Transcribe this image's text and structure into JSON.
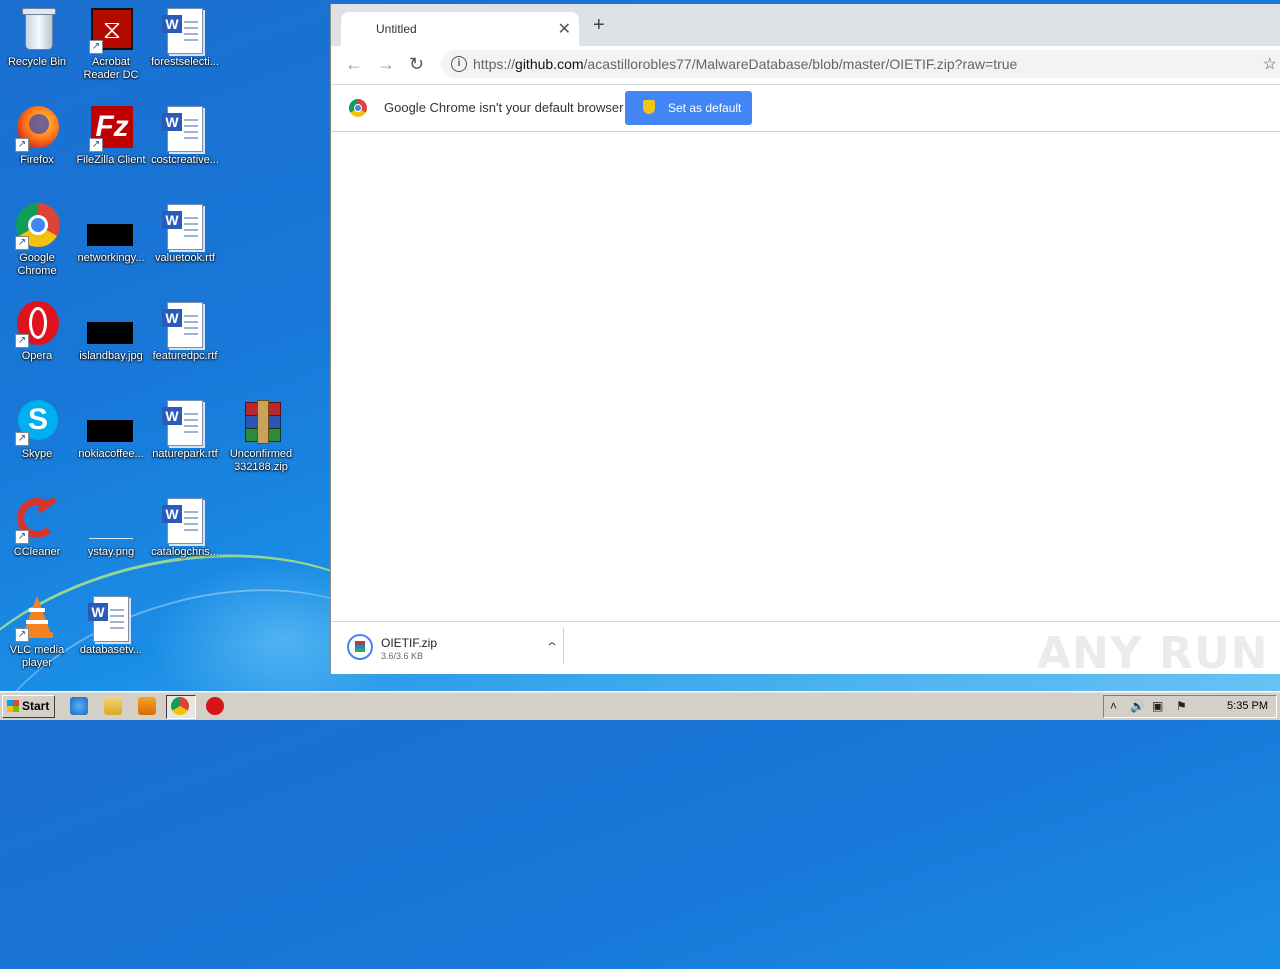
{
  "desktop": {
    "icons": [
      {
        "label": "Recycle Bin"
      },
      {
        "label": "Acrobat Reader DC"
      },
      {
        "label": "forestselecti..."
      },
      {
        "label": "Firefox"
      },
      {
        "label": "FileZilla Client"
      },
      {
        "label": "costcreative..."
      },
      {
        "label": "Google Chrome"
      },
      {
        "label": "networkingy..."
      },
      {
        "label": "valuetook.rtf"
      },
      {
        "label": "Opera"
      },
      {
        "label": "islandbay.jpg"
      },
      {
        "label": "featuredpc.rtf"
      },
      {
        "label": "Skype"
      },
      {
        "label": "nokiacoffee..."
      },
      {
        "label": "naturepark.rtf"
      },
      {
        "label": "Unconfirmed 332188.zip"
      },
      {
        "label": "CCleaner"
      },
      {
        "label": "ystay.png"
      },
      {
        "label": "catalogchris..."
      },
      {
        "label": "VLC media player"
      },
      {
        "label": "databasetv..."
      }
    ]
  },
  "browser": {
    "tab_title": "Untitled",
    "url_scheme": "https://",
    "url_host": "github.com",
    "url_path": "/acastillorobles77/MalwareDatabase/blob/master/OIETIF.zip?raw=true",
    "infobar_text": "Google Chrome isn't your default browser",
    "set_default_label": "Set as default",
    "download": {
      "name": "OIETIF.zip",
      "size": "3.6/3.6 KB"
    },
    "watermark": "ANY RUN"
  },
  "taskbar": {
    "start_label": "Start",
    "clock": "5:35 PM"
  },
  "colors": {
    "accent": "#4285f4",
    "desktop_bg": "#1a78d8",
    "taskbar": "#d4d0c8"
  }
}
